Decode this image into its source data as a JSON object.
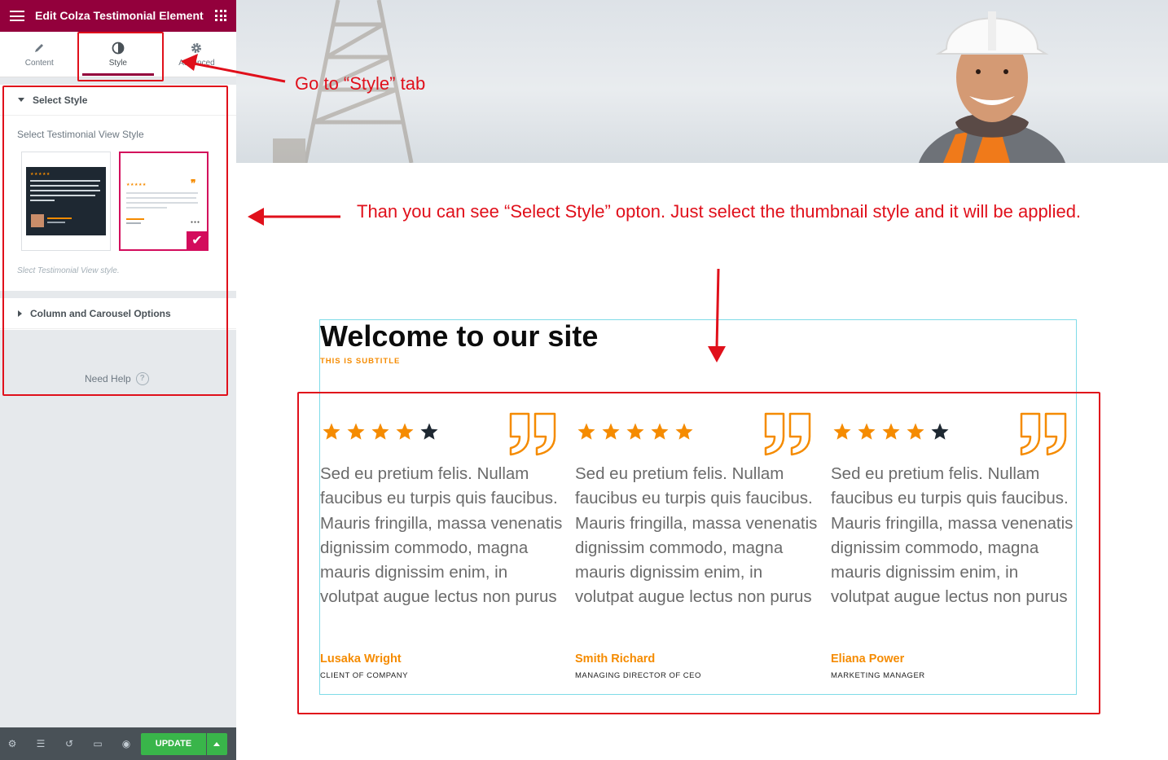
{
  "panel": {
    "title": "Edit Colza Testimonial Element",
    "tabs": [
      {
        "label": "Content",
        "icon": "pencil-icon"
      },
      {
        "label": "Style",
        "icon": "half-circle-icon"
      },
      {
        "label": "Advanced",
        "icon": "gear-icon"
      }
    ],
    "sections": {
      "select_style": {
        "heading": "Select Style",
        "control_label": "Select Testimonial View Style",
        "description": "Slect Testimonial View style.",
        "options": [
          "style-dark-card",
          "style-light-card"
        ],
        "selected": 2
      },
      "column_carousel": {
        "heading": "Column and Carousel Options"
      }
    },
    "need_help": "Need Help",
    "footer": {
      "update_label": "UPDATE"
    },
    "colors": {
      "header": "#93003c",
      "accent": "#d30c5c",
      "update": "#39b54a"
    }
  },
  "annotations": {
    "style_tab": "Go  to “Style” tab",
    "select_style": "Than you  can see “Select Style” opton. Just select the thumbnail style and it will be applied."
  },
  "preview": {
    "title": "Welcome to our site",
    "subtitle": "THIS IS SUBTITLE",
    "testimonials": [
      {
        "rating": 4,
        "text": "Sed eu pretium felis. Nullam faucibus eu turpis quis faucibus. Mauris fringilla, massa venenatis dignissim commodo, magna mauris dignissim enim, in volutpat augue lectus non purus",
        "name": "Lusaka Wright",
        "role": "CLIENT OF COMPANY"
      },
      {
        "rating": 5,
        "text": "Sed eu pretium felis. Nullam faucibus eu turpis quis faucibus. Mauris fringilla, massa venenatis dignissim commodo, magna mauris dignissim enim, in volutpat augue lectus non purus",
        "name": "Smith Richard",
        "role": "MANAGING DIRECTOR OF CEO"
      },
      {
        "rating": 4,
        "text": "Sed eu pretium felis. Nullam faucibus eu turpis quis faucibus. Mauris fringilla, massa venenatis dignissim commodo, magna mauris dignissim enim, in volutpat augue lectus non purus",
        "name": "Eliana Power",
        "role": "MARKETING MANAGER"
      }
    ],
    "colors": {
      "star_on": "#f58b00",
      "star_off": "#1e2832",
      "quote": "#f58b00",
      "annotation": "#e0101b"
    }
  }
}
